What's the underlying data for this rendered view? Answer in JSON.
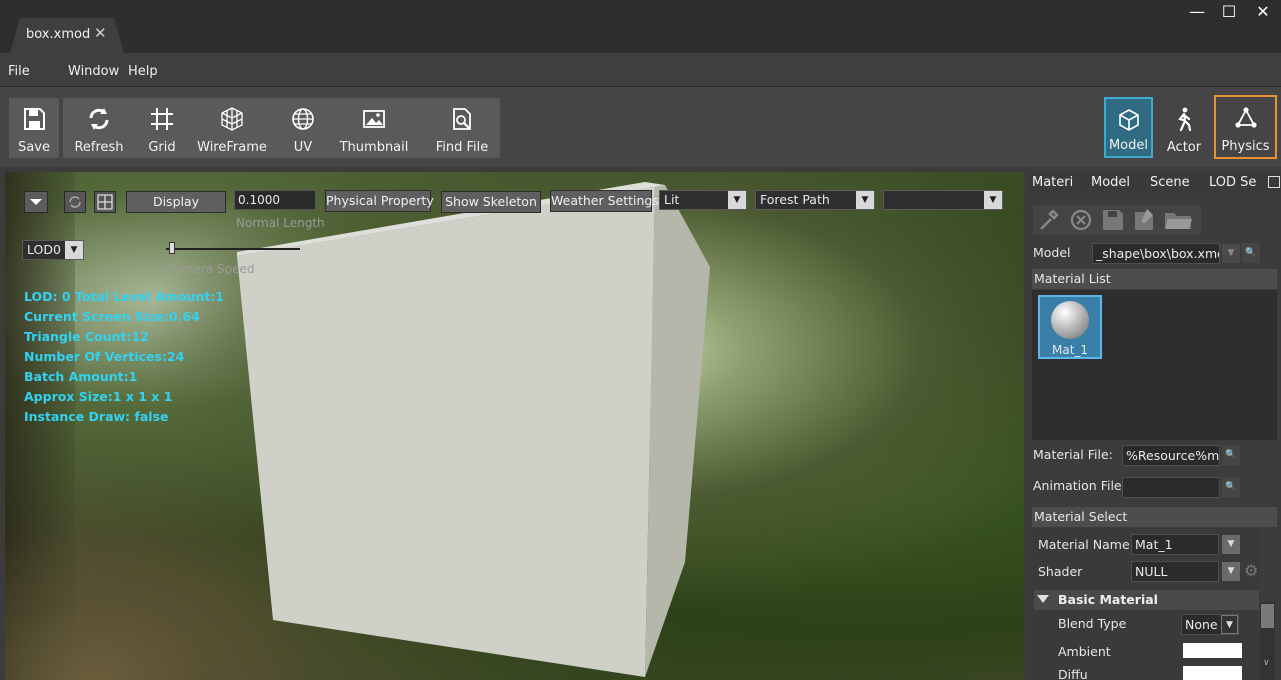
{
  "window": {
    "tab_title": "box.xmod",
    "tab_close": "✕",
    "controls": {
      "minimize": "—",
      "maximize": "☐",
      "close": "✕"
    }
  },
  "menu": {
    "file": "File",
    "window": "Window",
    "help": "Help"
  },
  "toolbar": {
    "save": "Save",
    "refresh": "Refresh",
    "grid": "Grid",
    "wireframe": "WireFrame",
    "uv": "UV",
    "thumbnail": "Thumbnail",
    "find_file": "Find File",
    "model": "Model",
    "actor": "Actor",
    "physics": "Physics"
  },
  "viewport": {
    "display_button": "Display",
    "normal_length_value": "0.1000",
    "normal_length_label": "Normal Length",
    "physical_property_button": "Physical Property",
    "show_skeleton_button": "Show Skeleton",
    "weather_settings_button": "Weather Settings",
    "shading_mode": "Lit",
    "environment": "Forest Path",
    "extra_combo": "",
    "lod_select": "LOD0",
    "camera_speed_label": "Camera Speed",
    "stats": {
      "lod": "LOD: 0 Total Level Amount:1",
      "screen_size": "Current Screen Size:0.64",
      "triangles": "Triangle Count:12",
      "vertices": "Number Of Vertices:24",
      "batch": "Batch Amount:1",
      "approx_size": "Approx Size:1 x 1 x 1",
      "instance_draw": "Instance Draw: false"
    }
  },
  "panel": {
    "tabs": [
      "Materi",
      "Model",
      "Scene",
      "LOD Se"
    ],
    "model_label": "Model",
    "model_value": "_shape\\box\\box.xmo",
    "material_list_title": "Material List",
    "material_item": "Mat_1",
    "material_file_label": "Material File:",
    "material_file_value": "%Resource%m",
    "animation_file_label": "Animation File:",
    "animation_file_value": "",
    "material_select_title": "Material Select",
    "material_name_label": "Material Name",
    "material_name_value": "Mat_1",
    "shader_label": "Shader",
    "shader_value": "NULL",
    "basic_material_title": "Basic Material",
    "blend_type_label": "Blend Type",
    "blend_type_value": "None",
    "ambient_label": "Ambient",
    "diffuse_label": "Diffu"
  },
  "colors": {
    "accent_selected": "#3fa9d0",
    "physics_highlight": "#e8922f",
    "stats_text": "#32d3f2"
  }
}
